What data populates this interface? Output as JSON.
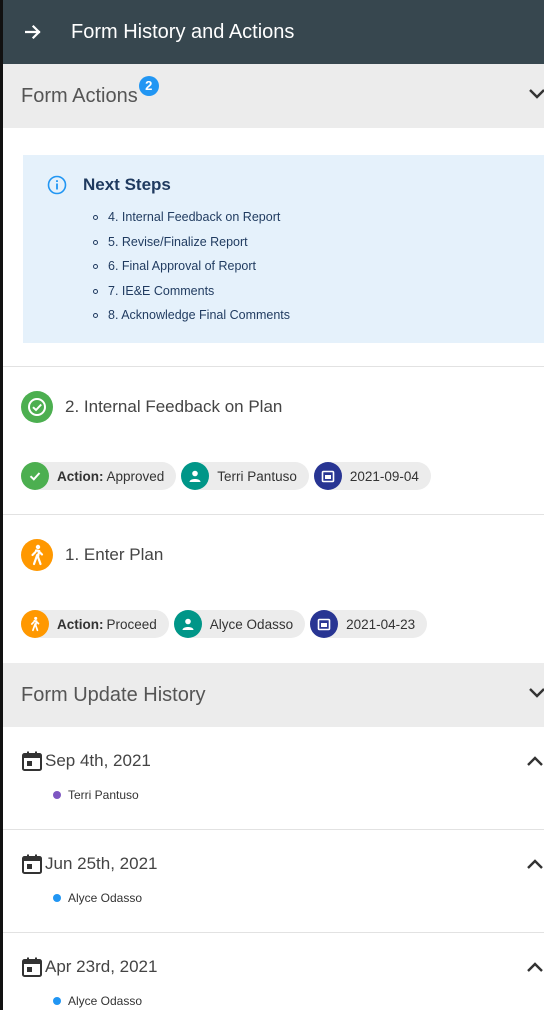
{
  "header": {
    "title": "Form History and Actions",
    "icon": "arrow-right-icon",
    "bg": "#37474f"
  },
  "form_actions": {
    "label": "Form Actions",
    "badge": "2",
    "badge_color": "#2196f3",
    "next_steps": {
      "title": "Next Steps",
      "items": [
        "4. Internal Feedback on Report",
        "5. Revise/Finalize Report",
        "6. Final Approval of Report",
        "7. IE&E Comments",
        "8. Acknowledge Final Comments"
      ]
    },
    "steps": [
      {
        "title": "2. Internal Feedback on Plan",
        "status_color": "#4caf50",
        "action_label": "Action:",
        "action_value": "Approved",
        "user": "Terri Pantuso",
        "user_icon_color": "#009688",
        "date": "2021-09-04",
        "date_icon_color": "#283593"
      },
      {
        "title": "1. Enter Plan",
        "status_color": "#ff9800",
        "action_label": "Action:",
        "action_value": "Proceed",
        "user": "Alyce Odasso",
        "user_icon_color": "#009688",
        "date": "2021-04-23",
        "date_icon_color": "#283593"
      }
    ]
  },
  "form_update_history": {
    "label": "Form Update History",
    "items": [
      {
        "date": "Sep 4th, 2021",
        "user": "Terri Pantuso",
        "dot_color": "#7e57c2"
      },
      {
        "date": "Jun 25th, 2021",
        "user": "Alyce Odasso",
        "dot_color": "#2196f3"
      },
      {
        "date": "Apr 23rd, 2021",
        "user": "Alyce Odasso",
        "dot_color": "#2196f3"
      }
    ]
  }
}
